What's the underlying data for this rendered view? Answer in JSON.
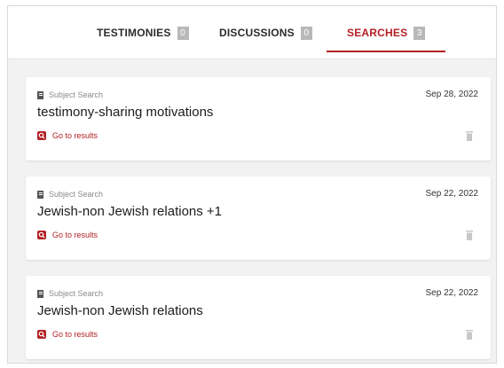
{
  "tabs": [
    {
      "label": "TESTIMONIES",
      "count": "0"
    },
    {
      "label": "DISCUSSIONS",
      "count": "0"
    },
    {
      "label": "SEARCHES",
      "count": "3"
    }
  ],
  "active_tab": "SEARCHES",
  "colors": {
    "accent": "#b32025",
    "badge": "#b8b8b8",
    "background": "#f2f2f2"
  },
  "searches": [
    {
      "type": "Subject Search",
      "title": "testimony-sharing motivations",
      "date": "Sep 28, 2022",
      "link": "Go to results",
      "icons": [
        "document-icon",
        "search-icon",
        "trash-icon"
      ]
    },
    {
      "type": "Subject Search",
      "title": "Jewish-non Jewish relations +1",
      "date": "Sep 22, 2022",
      "link": "Go to results",
      "icons": [
        "document-icon",
        "search-icon",
        "trash-icon"
      ]
    },
    {
      "type": "Subject Search",
      "title": "Jewish-non Jewish relations",
      "date": "Sep 22, 2022",
      "link": "Go to results",
      "icons": [
        "document-icon",
        "search-icon",
        "trash-icon"
      ]
    }
  ]
}
